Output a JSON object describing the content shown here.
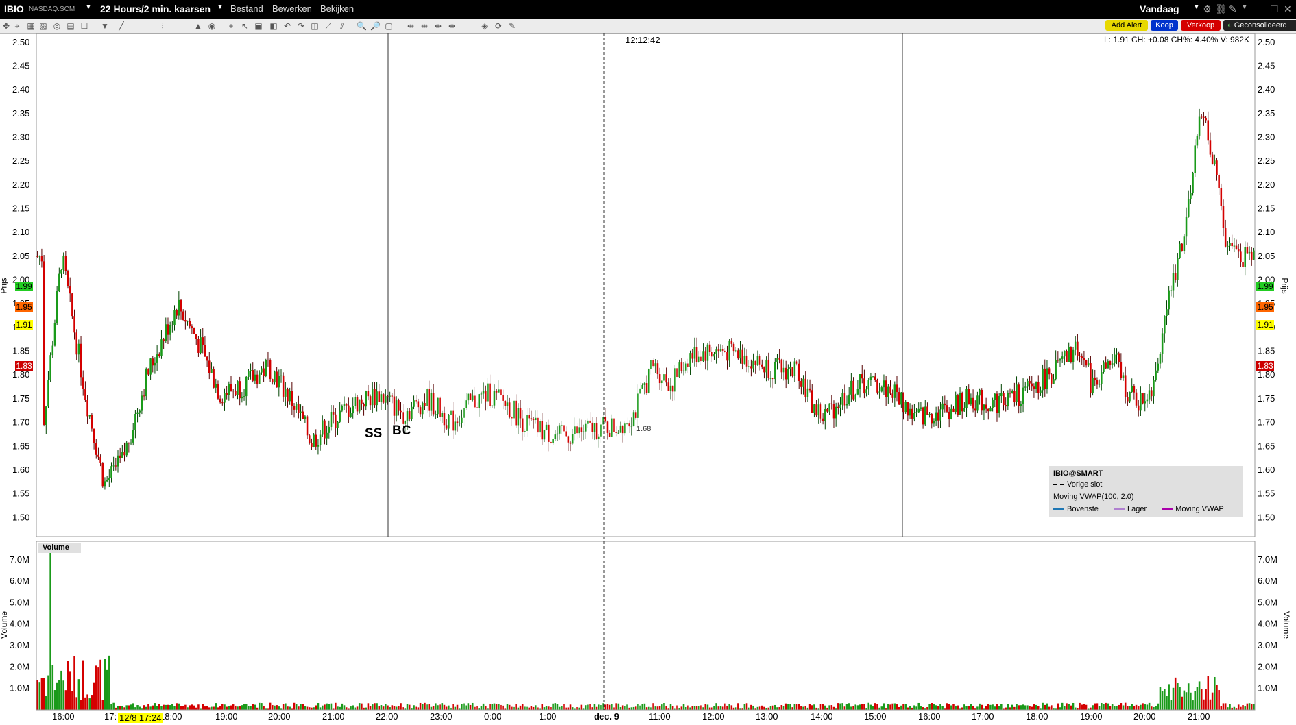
{
  "titlebar": {
    "symbol": "IBIO",
    "exchange": "NASDAQ.SCM",
    "period": "22 Hours/2 min. kaarsen",
    "menu": [
      "Bestand",
      "Bewerken",
      "Bekijken"
    ],
    "today_label": "Vandaag"
  },
  "actions": {
    "add_alert": "Add Alert",
    "buy": "Koop",
    "sell": "Verkoop",
    "consolidated": "Geconsolideerd"
  },
  "colors": {
    "up": "#1a9a1a",
    "down": "#d40000",
    "buy": "#0033cc",
    "sell": "#d40000",
    "alert": "#e8d800",
    "yellow_tag": "#ffff00",
    "orange_tag": "#ff6600",
    "green_tag": "#22cc22",
    "red_tag": "#cc0000"
  },
  "chart": {
    "cursor_time": "12:12:42",
    "info": "L: 1.91 CH: +0.08 CH%: 4.40% V: 982K",
    "price_axis_label": "Prijs",
    "volume_axis_label": "Volume",
    "volume_panel_title": "Volume",
    "price_ticks": [
      "2.50",
      "2.45",
      "2.40",
      "2.35",
      "2.30",
      "2.25",
      "2.20",
      "2.15",
      "2.10",
      "2.05",
      "2.00",
      "1.95",
      "1.90",
      "1.85",
      "1.80",
      "1.75",
      "1.70",
      "1.65",
      "1.60",
      "1.55",
      "1.50"
    ],
    "volume_ticks": [
      "7.0M",
      "6.0M",
      "5.0M",
      "4.0M",
      "3.0M",
      "2.0M",
      "1.0M"
    ],
    "time_labels": [
      "16:00",
      "17:",
      "18:00",
      "19:00",
      "20:00",
      "21:00",
      "22:00",
      "23:00",
      "0:00",
      "1:00",
      "dec. 9",
      "11:00",
      "12:00",
      "13:00",
      "14:00",
      "15:00",
      "16:00",
      "17:00",
      "18:00",
      "19:00",
      "20:00",
      "21:00"
    ],
    "time_highlight": "12/8 17:24",
    "price_tags": {
      "green": "1.99",
      "orange": "1.95",
      "yellow": "1.91",
      "red": "1.83"
    },
    "crosshair_price": "1.68",
    "session_markers": [
      "SS",
      "BC"
    ],
    "ylim": [
      1.46,
      2.52
    ]
  },
  "legend": {
    "title": "IBIO@SMART",
    "prev_close": "Vorige slot",
    "indicator": "Moving VWAP(100, 2.0)",
    "bands": [
      {
        "name": "Bovenste",
        "color": "#1f77b4"
      },
      {
        "name": "Lager",
        "color": "#b080d0"
      },
      {
        "name": "Moving VWAP",
        "color": "#aa00aa"
      }
    ]
  },
  "chart_data": {
    "type": "candlestick",
    "ylim": [
      1.46,
      2.52
    ],
    "series": [
      {
        "x": 0.005,
        "y": 1.7
      },
      {
        "x": 0.02,
        "y": 2.05
      },
      {
        "x": 0.04,
        "y": 1.75
      },
      {
        "x": 0.055,
        "y": 1.57
      },
      {
        "x": 0.07,
        "y": 1.62
      },
      {
        "x": 0.09,
        "y": 1.8
      },
      {
        "x": 0.115,
        "y": 1.95
      },
      {
        "x": 0.13,
        "y": 1.88
      },
      {
        "x": 0.15,
        "y": 1.76
      },
      {
        "x": 0.17,
        "y": 1.78
      },
      {
        "x": 0.19,
        "y": 1.82
      },
      {
        "x": 0.21,
        "y": 1.74
      },
      {
        "x": 0.225,
        "y": 1.66
      },
      {
        "x": 0.24,
        "y": 1.7
      },
      {
        "x": 0.26,
        "y": 1.74
      },
      {
        "x": 0.28,
        "y": 1.76
      },
      {
        "x": 0.3,
        "y": 1.72
      },
      {
        "x": 0.32,
        "y": 1.75
      },
      {
        "x": 0.34,
        "y": 1.7
      },
      {
        "x": 0.355,
        "y": 1.74
      },
      {
        "x": 0.37,
        "y": 1.76
      },
      {
        "x": 0.385,
        "y": 1.74
      },
      {
        "x": 0.4,
        "y": 1.7
      },
      {
        "x": 0.415,
        "y": 1.68
      },
      {
        "x": 0.43,
        "y": 1.67
      },
      {
        "x": 0.445,
        "y": 1.68
      },
      {
        "x": 0.46,
        "y": 1.69
      },
      {
        "x": 0.475,
        "y": 1.69
      },
      {
        "x": 0.49,
        "y": 1.72
      },
      {
        "x": 0.505,
        "y": 1.82
      },
      {
        "x": 0.52,
        "y": 1.78
      },
      {
        "x": 0.535,
        "y": 1.84
      },
      {
        "x": 0.55,
        "y": 1.85
      },
      {
        "x": 0.565,
        "y": 1.85
      },
      {
        "x": 0.58,
        "y": 1.84
      },
      {
        "x": 0.595,
        "y": 1.82
      },
      {
        "x": 0.61,
        "y": 1.81
      },
      {
        "x": 0.625,
        "y": 1.81
      },
      {
        "x": 0.635,
        "y": 1.74
      },
      {
        "x": 0.645,
        "y": 1.71
      },
      {
        "x": 0.66,
        "y": 1.75
      },
      {
        "x": 0.675,
        "y": 1.78
      },
      {
        "x": 0.69,
        "y": 1.78
      },
      {
        "x": 0.705,
        "y": 1.76
      },
      {
        "x": 0.72,
        "y": 1.71
      },
      {
        "x": 0.735,
        "y": 1.72
      },
      {
        "x": 0.75,
        "y": 1.73
      },
      {
        "x": 0.765,
        "y": 1.75
      },
      {
        "x": 0.78,
        "y": 1.74
      },
      {
        "x": 0.795,
        "y": 1.75
      },
      {
        "x": 0.81,
        "y": 1.76
      },
      {
        "x": 0.825,
        "y": 1.79
      },
      {
        "x": 0.84,
        "y": 1.82
      },
      {
        "x": 0.855,
        "y": 1.86
      },
      {
        "x": 0.865,
        "y": 1.78
      },
      {
        "x": 0.875,
        "y": 1.81
      },
      {
        "x": 0.885,
        "y": 1.83
      },
      {
        "x": 0.895,
        "y": 1.76
      },
      {
        "x": 0.905,
        "y": 1.74
      },
      {
        "x": 0.915,
        "y": 1.78
      },
      {
        "x": 0.93,
        "y": 1.98
      },
      {
        "x": 0.945,
        "y": 2.15
      },
      {
        "x": 0.955,
        "y": 2.37
      },
      {
        "x": 0.965,
        "y": 2.25
      },
      {
        "x": 0.975,
        "y": 2.08
      },
      {
        "x": 0.99,
        "y": 2.05
      }
    ]
  }
}
